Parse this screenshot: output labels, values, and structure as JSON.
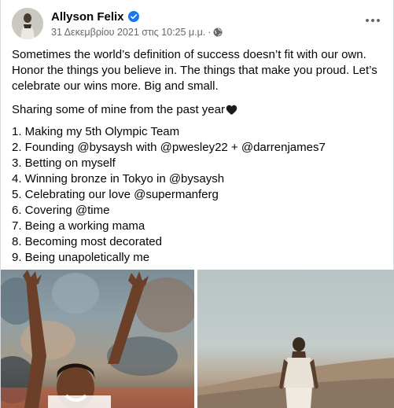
{
  "post": {
    "author": "Allyson Felix",
    "verified_icon": "verified-badge-icon",
    "date": "31 Δεκεμβρίου 2021 στις 10:25 μ.μ.",
    "separator": "·",
    "privacy_icon": "globe-icon",
    "more_icon": "more-options-icon",
    "intro": "Sometimes the world’s definition of success doesn’t fit with our own. Honor the things you believe in. The things that make you proud. Let’s celebrate our wins more. Big and small.",
    "sharing": "Sharing some of mine from the past year",
    "heart_icon": "black-heart-icon",
    "list": [
      "1. Making my 5th Olympic Team",
      "2. Founding @bysaysh with @pwesley22 + @darrenjames7",
      "3. Betting on myself",
      "4. Winning bronze in Tokyo in @bysaysh",
      "5. Celebrating our love @supermanferg",
      "6. Covering @time",
      "7. Being a working mama",
      "8. Becoming most decorated",
      "9. Being unapoletically me"
    ]
  },
  "colors": {
    "text": "#050505",
    "secondary_text": "#65676b",
    "verified_blue": "#1877f2"
  }
}
